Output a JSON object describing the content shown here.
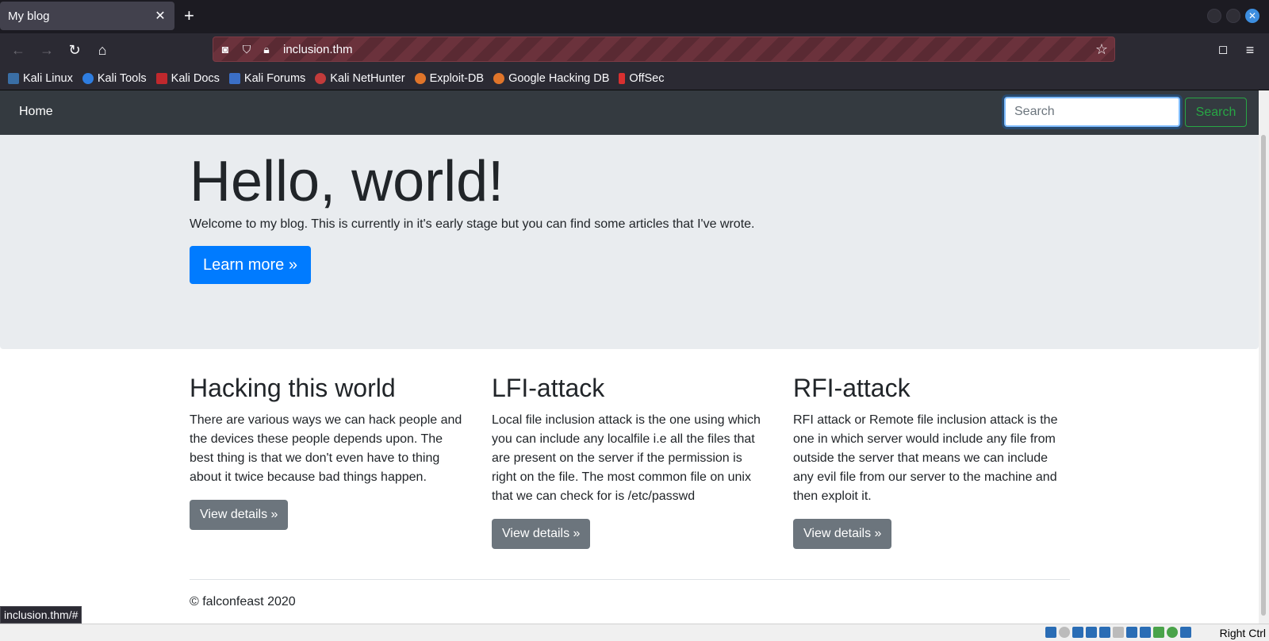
{
  "browser": {
    "tab_title": "My blog",
    "tab_close": "✕",
    "new_tab": "+",
    "url": "inclusion.thm",
    "bookmarks": [
      "Kali Linux",
      "Kali Tools",
      "Kali Docs",
      "Kali Forums",
      "Kali NetHunter",
      "Exploit-DB",
      "Google Hacking DB",
      "OffSec"
    ],
    "status_url": "inclusion.thm/#"
  },
  "site": {
    "nav_home": "Home",
    "search_placeholder": "Search",
    "search_button": "Search"
  },
  "jumbotron": {
    "title": "Hello, world!",
    "text": "Welcome to my blog. This is currently in it's early stage but you can find some articles that I've wrote.",
    "button": "Learn more »"
  },
  "articles": [
    {
      "title": "Hacking this world",
      "body": "There are various ways we can hack people and the devices these people depends upon. The best thing is that we don't even have to thing about it twice because bad things happen.",
      "button": "View details »"
    },
    {
      "title": "LFI-attack",
      "body": "Local file inclusion attack is the one using which you can include any localfile i.e all the files that are present on the server if the permission is right on the file. The most common file on unix that we can check for is /etc/passwd",
      "button": "View details »"
    },
    {
      "title": "RFI-attack",
      "body": "RFI attack or Remote file inclusion attack is the one in which server would include any file from outside the server that means we can include any evil file from our server to the machine and then exploit it.",
      "button": "View details »"
    }
  ],
  "footer": "© falconfeast 2020",
  "vbox": {
    "host_key": "Right Ctrl"
  },
  "colors": {
    "primary": "#007bff",
    "secondary": "#6c757d",
    "success": "#28a745",
    "navbar": "#343a40",
    "jumbotron": "#e9ecef"
  }
}
